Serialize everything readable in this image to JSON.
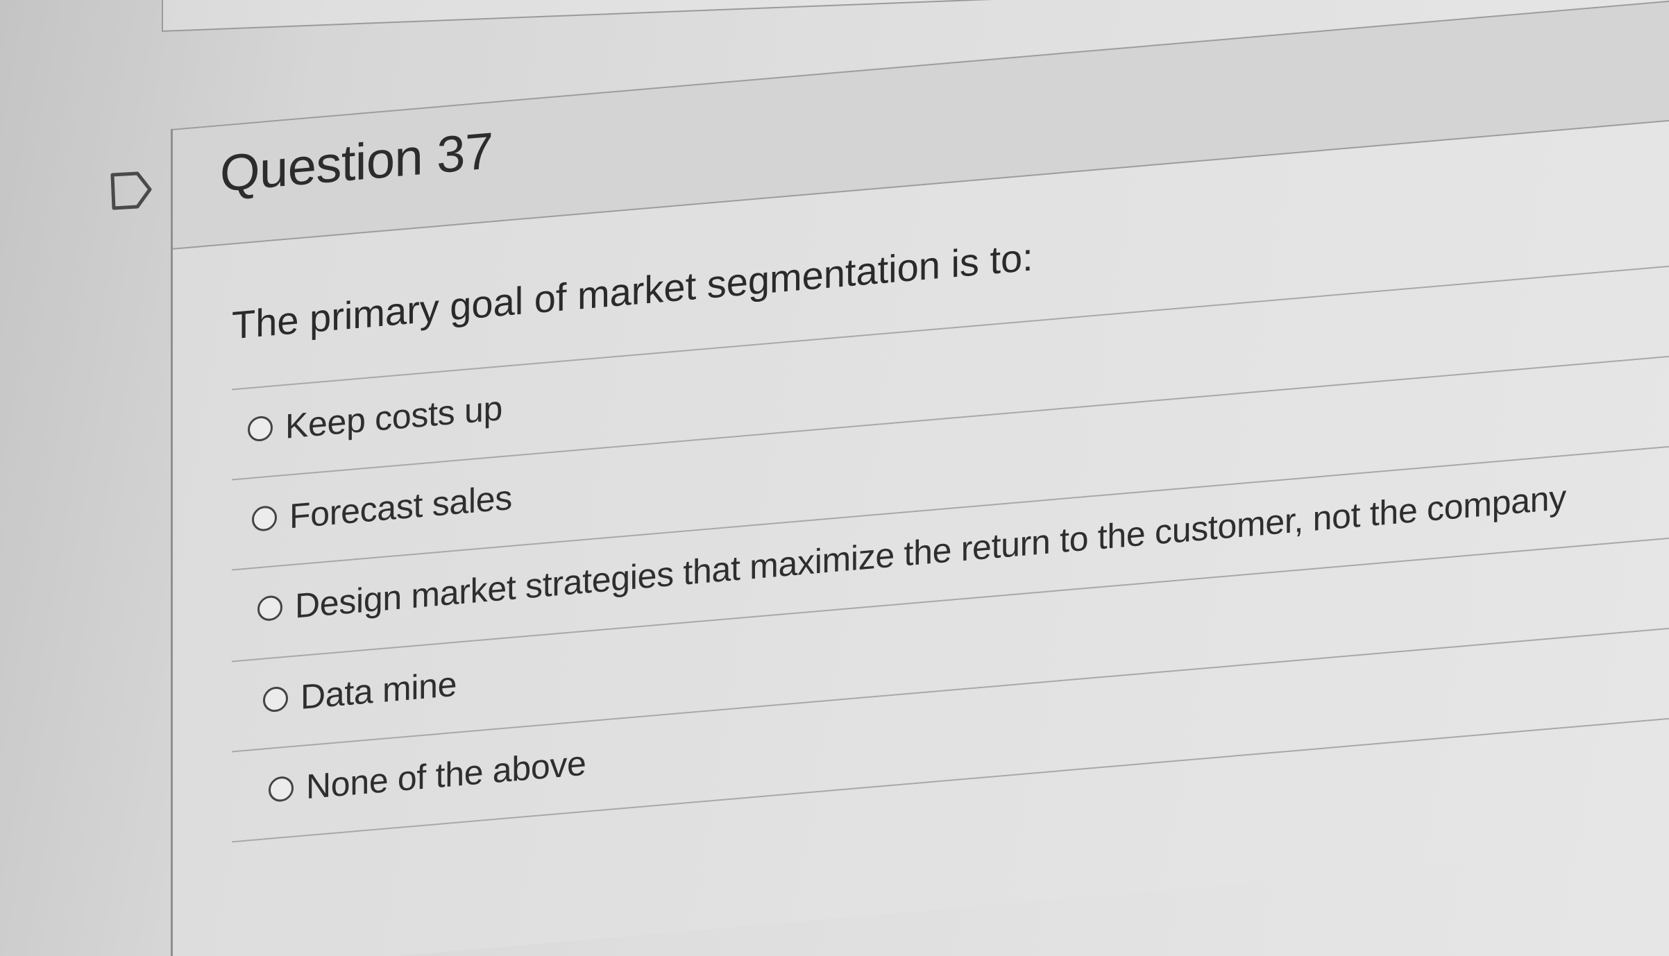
{
  "question": {
    "title": "Question 37",
    "prompt": "The primary goal of market segmentation is to:",
    "flag_icon": "flag-outline-icon",
    "answers": [
      {
        "label": "Keep costs up"
      },
      {
        "label": "Forecast sales"
      },
      {
        "label": "Design market strategies that maximize the return to the customer, not the company"
      },
      {
        "label": "Data mine"
      },
      {
        "label": "None of the above"
      }
    ]
  }
}
